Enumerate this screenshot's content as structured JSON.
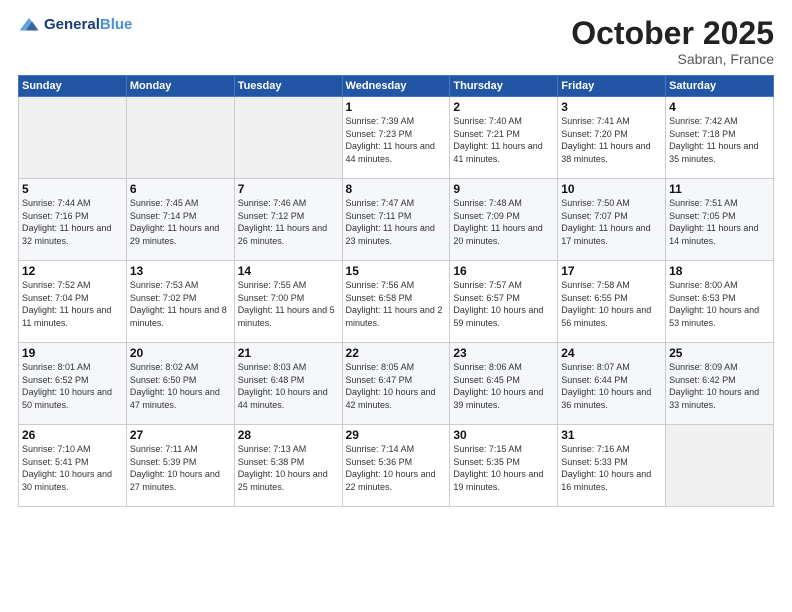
{
  "header": {
    "logo_line1": "General",
    "logo_line2": "Blue",
    "month": "October 2025",
    "location": "Sabran, France"
  },
  "weekdays": [
    "Sunday",
    "Monday",
    "Tuesday",
    "Wednesday",
    "Thursday",
    "Friday",
    "Saturday"
  ],
  "weeks": [
    [
      {
        "day": "",
        "sunrise": "",
        "sunset": "",
        "daylight": ""
      },
      {
        "day": "",
        "sunrise": "",
        "sunset": "",
        "daylight": ""
      },
      {
        "day": "",
        "sunrise": "",
        "sunset": "",
        "daylight": ""
      },
      {
        "day": "1",
        "sunrise": "Sunrise: 7:39 AM",
        "sunset": "Sunset: 7:23 PM",
        "daylight": "Daylight: 11 hours and 44 minutes."
      },
      {
        "day": "2",
        "sunrise": "Sunrise: 7:40 AM",
        "sunset": "Sunset: 7:21 PM",
        "daylight": "Daylight: 11 hours and 41 minutes."
      },
      {
        "day": "3",
        "sunrise": "Sunrise: 7:41 AM",
        "sunset": "Sunset: 7:20 PM",
        "daylight": "Daylight: 11 hours and 38 minutes."
      },
      {
        "day": "4",
        "sunrise": "Sunrise: 7:42 AM",
        "sunset": "Sunset: 7:18 PM",
        "daylight": "Daylight: 11 hours and 35 minutes."
      }
    ],
    [
      {
        "day": "5",
        "sunrise": "Sunrise: 7:44 AM",
        "sunset": "Sunset: 7:16 PM",
        "daylight": "Daylight: 11 hours and 32 minutes."
      },
      {
        "day": "6",
        "sunrise": "Sunrise: 7:45 AM",
        "sunset": "Sunset: 7:14 PM",
        "daylight": "Daylight: 11 hours and 29 minutes."
      },
      {
        "day": "7",
        "sunrise": "Sunrise: 7:46 AM",
        "sunset": "Sunset: 7:12 PM",
        "daylight": "Daylight: 11 hours and 26 minutes."
      },
      {
        "day": "8",
        "sunrise": "Sunrise: 7:47 AM",
        "sunset": "Sunset: 7:11 PM",
        "daylight": "Daylight: 11 hours and 23 minutes."
      },
      {
        "day": "9",
        "sunrise": "Sunrise: 7:48 AM",
        "sunset": "Sunset: 7:09 PM",
        "daylight": "Daylight: 11 hours and 20 minutes."
      },
      {
        "day": "10",
        "sunrise": "Sunrise: 7:50 AM",
        "sunset": "Sunset: 7:07 PM",
        "daylight": "Daylight: 11 hours and 17 minutes."
      },
      {
        "day": "11",
        "sunrise": "Sunrise: 7:51 AM",
        "sunset": "Sunset: 7:05 PM",
        "daylight": "Daylight: 11 hours and 14 minutes."
      }
    ],
    [
      {
        "day": "12",
        "sunrise": "Sunrise: 7:52 AM",
        "sunset": "Sunset: 7:04 PM",
        "daylight": "Daylight: 11 hours and 11 minutes."
      },
      {
        "day": "13",
        "sunrise": "Sunrise: 7:53 AM",
        "sunset": "Sunset: 7:02 PM",
        "daylight": "Daylight: 11 hours and 8 minutes."
      },
      {
        "day": "14",
        "sunrise": "Sunrise: 7:55 AM",
        "sunset": "Sunset: 7:00 PM",
        "daylight": "Daylight: 11 hours and 5 minutes."
      },
      {
        "day": "15",
        "sunrise": "Sunrise: 7:56 AM",
        "sunset": "Sunset: 6:58 PM",
        "daylight": "Daylight: 11 hours and 2 minutes."
      },
      {
        "day": "16",
        "sunrise": "Sunrise: 7:57 AM",
        "sunset": "Sunset: 6:57 PM",
        "daylight": "Daylight: 10 hours and 59 minutes."
      },
      {
        "day": "17",
        "sunrise": "Sunrise: 7:58 AM",
        "sunset": "Sunset: 6:55 PM",
        "daylight": "Daylight: 10 hours and 56 minutes."
      },
      {
        "day": "18",
        "sunrise": "Sunrise: 8:00 AM",
        "sunset": "Sunset: 6:53 PM",
        "daylight": "Daylight: 10 hours and 53 minutes."
      }
    ],
    [
      {
        "day": "19",
        "sunrise": "Sunrise: 8:01 AM",
        "sunset": "Sunset: 6:52 PM",
        "daylight": "Daylight: 10 hours and 50 minutes."
      },
      {
        "day": "20",
        "sunrise": "Sunrise: 8:02 AM",
        "sunset": "Sunset: 6:50 PM",
        "daylight": "Daylight: 10 hours and 47 minutes."
      },
      {
        "day": "21",
        "sunrise": "Sunrise: 8:03 AM",
        "sunset": "Sunset: 6:48 PM",
        "daylight": "Daylight: 10 hours and 44 minutes."
      },
      {
        "day": "22",
        "sunrise": "Sunrise: 8:05 AM",
        "sunset": "Sunset: 6:47 PM",
        "daylight": "Daylight: 10 hours and 42 minutes."
      },
      {
        "day": "23",
        "sunrise": "Sunrise: 8:06 AM",
        "sunset": "Sunset: 6:45 PM",
        "daylight": "Daylight: 10 hours and 39 minutes."
      },
      {
        "day": "24",
        "sunrise": "Sunrise: 8:07 AM",
        "sunset": "Sunset: 6:44 PM",
        "daylight": "Daylight: 10 hours and 36 minutes."
      },
      {
        "day": "25",
        "sunrise": "Sunrise: 8:09 AM",
        "sunset": "Sunset: 6:42 PM",
        "daylight": "Daylight: 10 hours and 33 minutes."
      }
    ],
    [
      {
        "day": "26",
        "sunrise": "Sunrise: 7:10 AM",
        "sunset": "Sunset: 5:41 PM",
        "daylight": "Daylight: 10 hours and 30 minutes."
      },
      {
        "day": "27",
        "sunrise": "Sunrise: 7:11 AM",
        "sunset": "Sunset: 5:39 PM",
        "daylight": "Daylight: 10 hours and 27 minutes."
      },
      {
        "day": "28",
        "sunrise": "Sunrise: 7:13 AM",
        "sunset": "Sunset: 5:38 PM",
        "daylight": "Daylight: 10 hours and 25 minutes."
      },
      {
        "day": "29",
        "sunrise": "Sunrise: 7:14 AM",
        "sunset": "Sunset: 5:36 PM",
        "daylight": "Daylight: 10 hours and 22 minutes."
      },
      {
        "day": "30",
        "sunrise": "Sunrise: 7:15 AM",
        "sunset": "Sunset: 5:35 PM",
        "daylight": "Daylight: 10 hours and 19 minutes."
      },
      {
        "day": "31",
        "sunrise": "Sunrise: 7:16 AM",
        "sunset": "Sunset: 5:33 PM",
        "daylight": "Daylight: 10 hours and 16 minutes."
      },
      {
        "day": "",
        "sunrise": "",
        "sunset": "",
        "daylight": ""
      }
    ]
  ]
}
